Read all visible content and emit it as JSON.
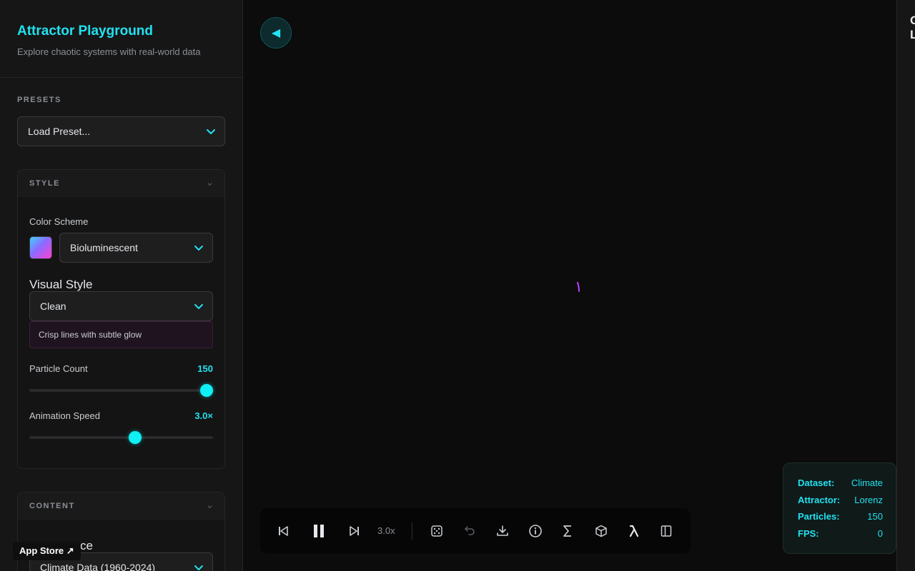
{
  "app": {
    "title": "Attractor Playground",
    "subtitle": "Explore chaotic systems with real-world data"
  },
  "presets": {
    "label": "PRESETS",
    "select_value": "Load Preset..."
  },
  "style_panel": {
    "label": "STYLE",
    "color_scheme_label": "Color Scheme",
    "color_scheme_value": "Bioluminescent",
    "visual_style_label": "Visual Style",
    "visual_style_value": "Clean",
    "visual_style_hint": "Crisp lines with subtle glow",
    "particle_count_label": "Particle Count",
    "particle_count_value": "150",
    "particle_count_fraction": 1.0,
    "animation_speed_label": "Animation Speed",
    "animation_speed_value": "3.0×",
    "animation_speed_fraction": 0.58
  },
  "content_panel": {
    "label": "CONTENT",
    "data_source_label_partial": "ce",
    "data_source_value": "Climate Data (1960-2024)"
  },
  "app_store_link": "App Store ↗",
  "toolbar": {
    "speed": "3.0x",
    "icons": [
      "skip-back-icon",
      "pause-icon",
      "skip-forward-icon",
      "dice-icon",
      "undo-icon",
      "download-icon",
      "info-icon",
      "sigma-icon",
      "cube-icon",
      "lambda-icon",
      "panel-icon"
    ]
  },
  "stats": {
    "dataset_label": "Dataset:",
    "dataset_value": "Climate",
    "attractor_label": "Attractor:",
    "attractor_value": "Lorenz",
    "particles_label": "Particles:",
    "particles_value": "150",
    "fps_label": "FPS:",
    "fps_value": "0"
  },
  "right_panel": {
    "line1": "G",
    "line2": "L"
  },
  "colors": {
    "accent": "#22e1f0",
    "particle": "#c040ff"
  }
}
